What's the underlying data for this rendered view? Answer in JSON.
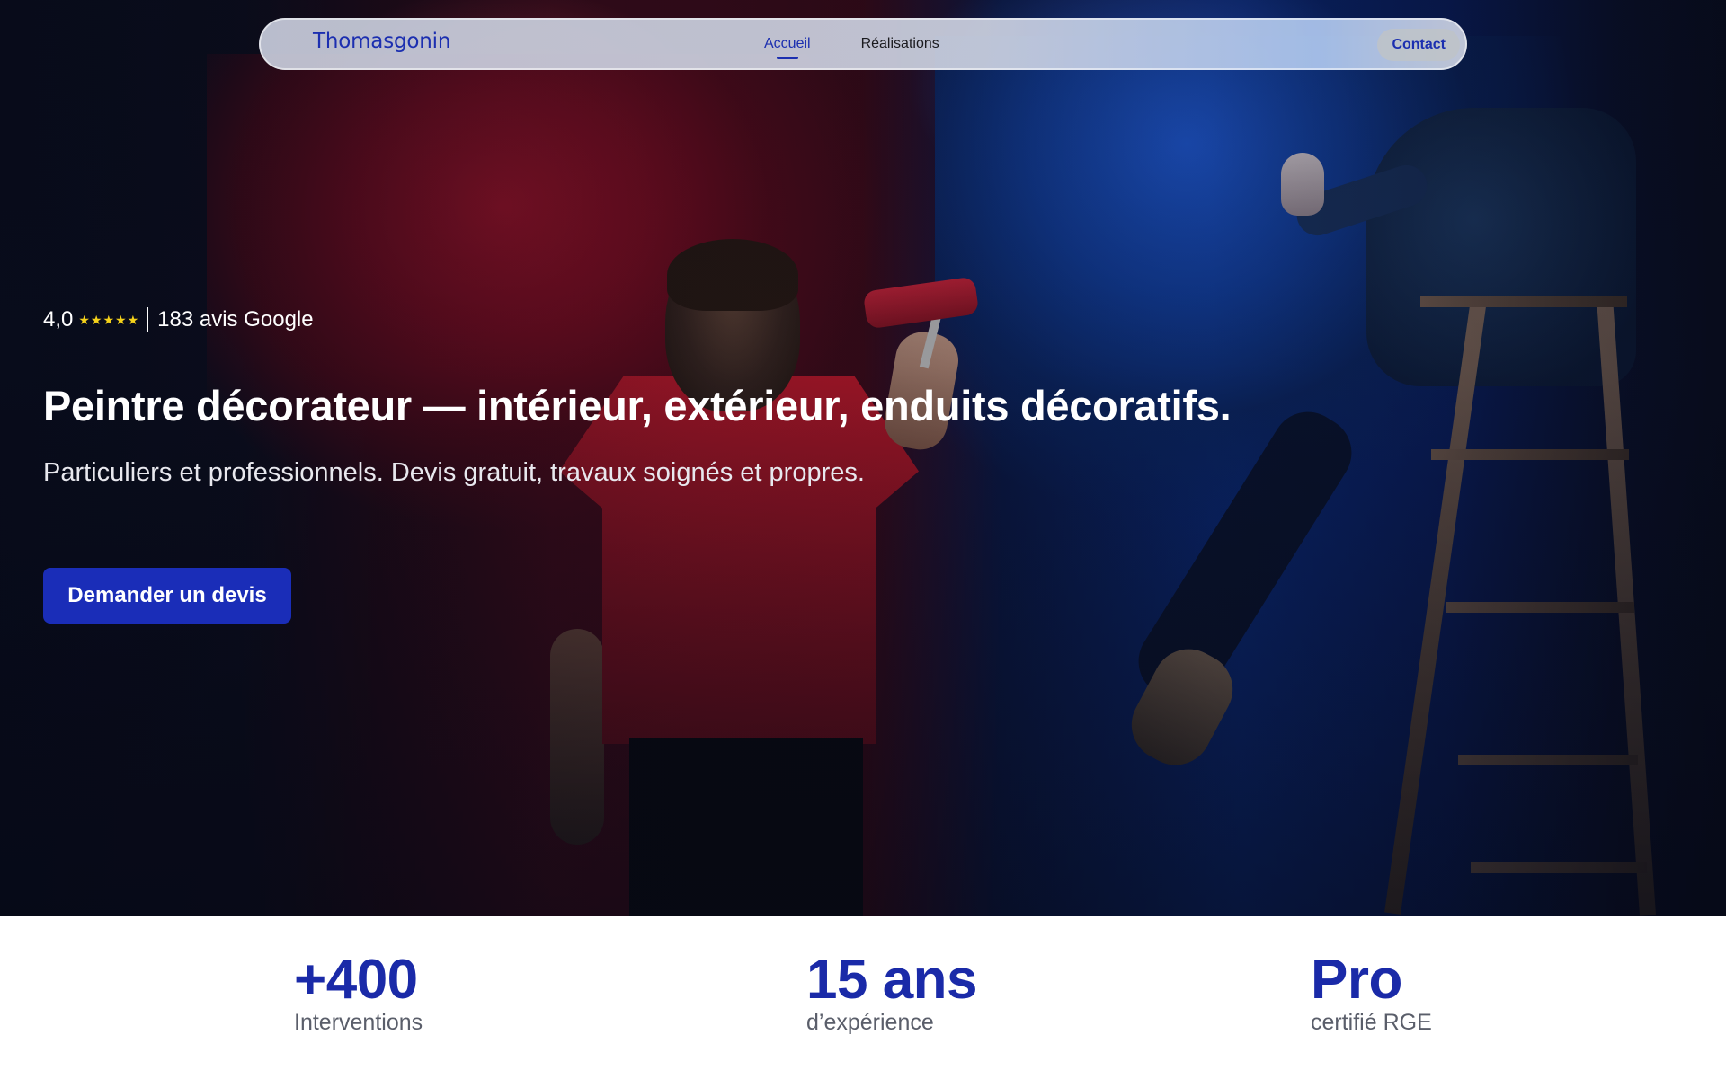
{
  "navbar": {
    "logo_text": "Thomasgonin",
    "links": [
      {
        "label": "Accueil",
        "active": true
      },
      {
        "label": "Réalisations",
        "active": false
      }
    ],
    "contact_label": "Contact",
    "accent_color": "#1c2fb0"
  },
  "hero": {
    "rating": {
      "score": "4,0",
      "stars": "★★★★★",
      "reviews": "183 avis Google"
    },
    "headline": "Peintre décorateur — intérieur, extérieur, enduits décoratifs.",
    "subheadline": "Particuliers et professionnels. Devis gratuit, travaux soignés et propres.",
    "cta_label": "Demander un devis",
    "cta_color": "#1a2db8",
    "background_image": "painter-red-blue-wall-photo"
  },
  "stats": [
    {
      "value": "+400",
      "label": "Interventions"
    },
    {
      "value": "15 ans",
      "label": "d’expérience"
    },
    {
      "value": "Pro",
      "label": "certifié RGE"
    }
  ]
}
